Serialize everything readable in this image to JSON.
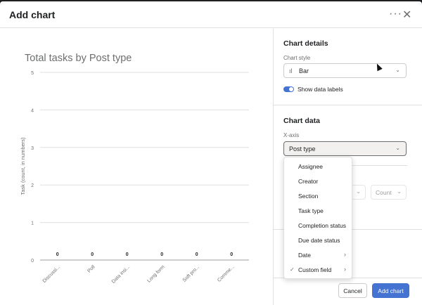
{
  "dialog": {
    "title": "Add chart",
    "more_icon": "more-horizontal-icon",
    "more_glyph": "···",
    "close_icon": "close-icon",
    "close_glyph": "✕"
  },
  "chart_data": {
    "type": "bar",
    "title": "Total tasks by Post type",
    "ylabel": "Task (count, in numbers)",
    "xlabel": "",
    "categories": [
      "Discussi...",
      "Poll",
      "Data insi...",
      "Long form",
      "Soft pro...",
      "Comme..."
    ],
    "values": [
      0,
      0,
      0,
      0,
      0,
      0
    ],
    "data_labels": [
      "0",
      "0",
      "0",
      "0",
      "0",
      "0"
    ],
    "yticks": [
      "0",
      "1",
      "2",
      "3",
      "4",
      "5"
    ],
    "ylim": [
      0,
      5
    ],
    "grid": true
  },
  "details": {
    "section_title": "Chart details",
    "style_label": "Chart style",
    "style_value": "Bar",
    "style_icon": "bar-chart-icon",
    "style_icon_glyph": "ıl",
    "chevron_glyph": "⌄",
    "show_labels": "Show data labels",
    "show_labels_on": true
  },
  "data_section": {
    "section_title": "Chart data",
    "xaxis_label": "X-axis",
    "xaxis_value": "Post type",
    "yaxis_value": "Count"
  },
  "menu": {
    "items": [
      {
        "label": "Assignee",
        "checked": false,
        "submenu": false
      },
      {
        "label": "Creator",
        "checked": false,
        "submenu": false
      },
      {
        "label": "Section",
        "checked": false,
        "submenu": false
      },
      {
        "label": "Task type",
        "checked": false,
        "submenu": false
      },
      {
        "label": "Completion status",
        "checked": false,
        "submenu": false
      },
      {
        "label": "Due date status",
        "checked": false,
        "submenu": false
      },
      {
        "label": "Date",
        "checked": false,
        "submenu": true
      },
      {
        "label": "Custom field",
        "checked": true,
        "submenu": true
      }
    ],
    "check_glyph": "✓",
    "arrow_glyph": "›"
  },
  "footer": {
    "cancel_label": "Cancel",
    "add_label": "Add chart"
  },
  "colors": {
    "accent": "#4573d2",
    "grid": "#e0e0e0",
    "axis": "#6d6e6f"
  }
}
